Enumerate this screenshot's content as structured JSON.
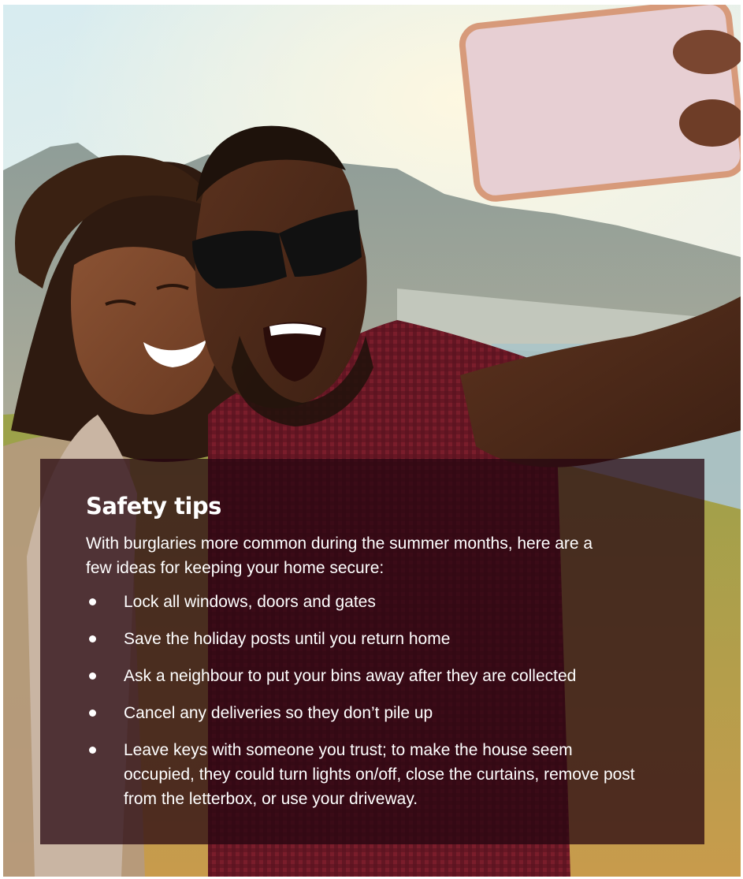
{
  "photo": {
    "subject": "couple-taking-selfie",
    "colors": {
      "sky": "#e6f0ee",
      "mountain": "#7e8a84",
      "shirt": "#7d1d2a",
      "skin": "#6e3d24",
      "phone": "#e7cfd3"
    }
  },
  "card": {
    "title": "Safety tips",
    "intro": "With burglaries more common during the summer months, here are a few ideas for keeping your home secure:",
    "tips": [
      {
        "text": "Lock all windows, doors and gates"
      },
      {
        "text": "Save the holiday posts until you return home"
      },
      {
        "text": "Ask a neighbour to put your bins away after they are collected"
      },
      {
        "text": "Cancel any deliveries so they don’t pile up"
      },
      {
        "text": "Leave keys with someone you trust; to make the house seem occupied, they could turn lights on/off, close the curtains, remove post from the letterbox, or use your driveway."
      }
    ],
    "colors": {
      "overlay": "#260610",
      "text": "#ffffff"
    }
  }
}
